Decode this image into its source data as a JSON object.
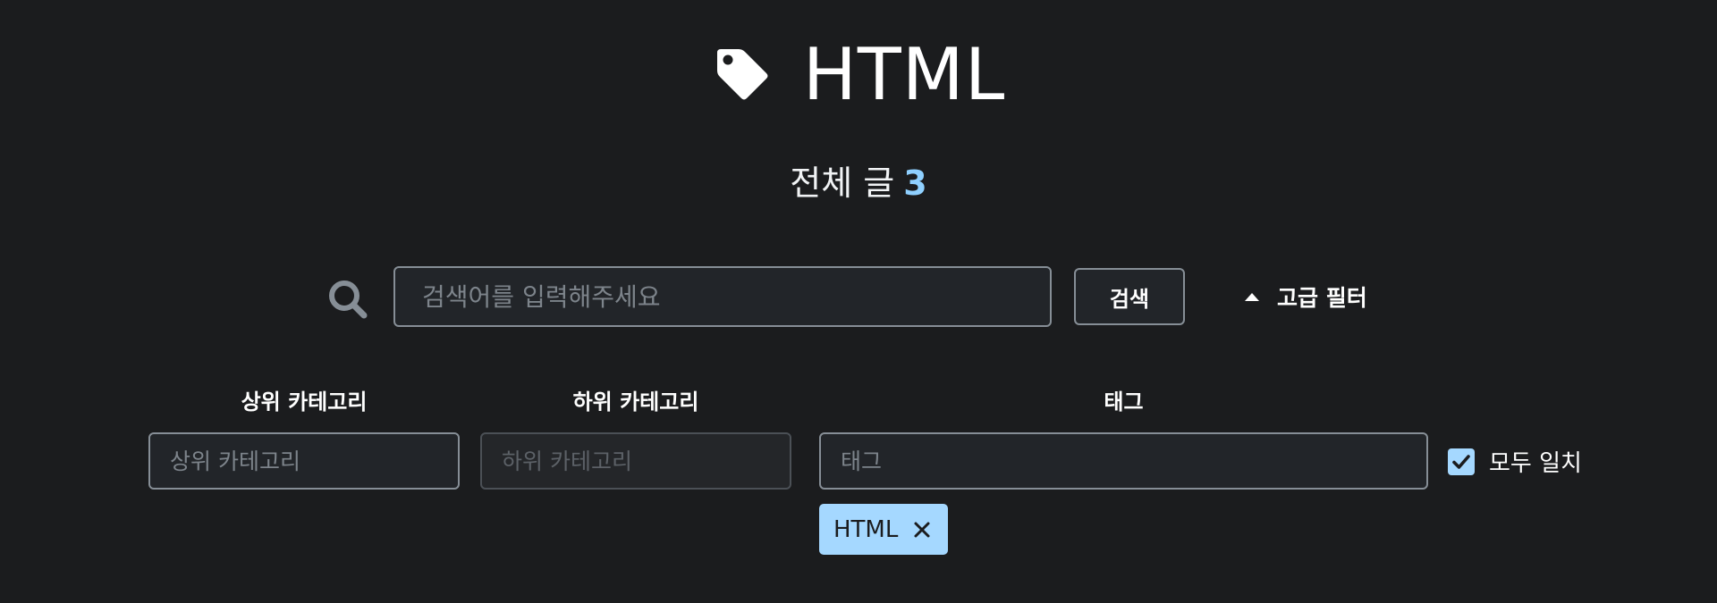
{
  "header": {
    "title": "HTML",
    "count_label": "전체 글",
    "count_value": "3"
  },
  "search": {
    "placeholder": "검색어를 입력해주세요",
    "value": "",
    "button_label": "검색",
    "advanced_filter_label": "고급 필터"
  },
  "filters": {
    "parent_category": {
      "label": "상위 카테고리",
      "placeholder": "상위 카테고리"
    },
    "sub_category": {
      "label": "하위 카테고리",
      "placeholder": "하위 카테고리"
    },
    "tag": {
      "label": "태그",
      "placeholder": "태그"
    },
    "match_all_label": "모두 일치",
    "match_all_checked": true,
    "selected_tags": [
      "HTML"
    ]
  },
  "icons": {
    "title": "tag-icon",
    "search": "search-icon",
    "advanced_filter": "caret-up-icon",
    "checkbox": "check-icon",
    "chip_remove": "close-icon"
  },
  "colors": {
    "background": "#1b1c1e",
    "accent": "#8fd0ff",
    "chip": "#a5d8ff"
  }
}
